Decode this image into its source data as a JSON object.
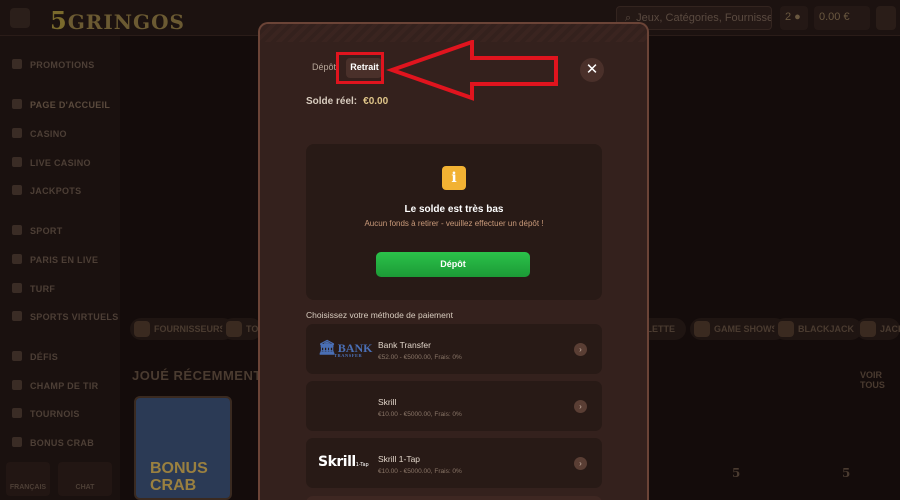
{
  "header": {
    "logo_number": "5",
    "logo_text": "GRINGOS",
    "search_placeholder": "Jeux, Catégories, Fournisseurs",
    "coins": "2",
    "balance": "0.00 €"
  },
  "sidebar": {
    "items": [
      {
        "label": "PROMOTIONS",
        "icon": "gift-icon"
      },
      {
        "label": "PAGE D'ACCUEIL",
        "icon": "home-icon"
      },
      {
        "label": "CASINO",
        "icon": "slot-icon"
      },
      {
        "label": "LIVE CASINO",
        "icon": "live-icon"
      },
      {
        "label": "JACKPOTS",
        "icon": "jackpot-icon"
      },
      {
        "label": "SPORT",
        "icon": "ball-icon"
      },
      {
        "label": "PARIS EN LIVE",
        "icon": "live-bet-icon"
      },
      {
        "label": "TURF",
        "icon": "horse-icon"
      },
      {
        "label": "SPORTS VIRTUELS",
        "icon": "virtual-icon"
      },
      {
        "label": "DÉFIS",
        "icon": "challenge-icon"
      },
      {
        "label": "CHAMP DE TIR",
        "icon": "target-icon"
      },
      {
        "label": "TOURNOIS",
        "icon": "trophy-icon"
      },
      {
        "label": "BONUS CRAB",
        "icon": "crab-icon"
      }
    ],
    "footer": {
      "language": "FRANÇAIS",
      "chat": "CHAT"
    }
  },
  "main": {
    "recent_title": "JOUÉ RÉCEMMENT",
    "see_all": "VOIR TOUS",
    "categories": [
      "FOURNISSEURS",
      "TO",
      "ULETTE",
      "GAME SHOWS",
      "BLACKJACK",
      "JACK"
    ],
    "game_card_title": "BONUS CRAB"
  },
  "modal": {
    "tabs": {
      "depot": "Dépôt",
      "retrait": "Retrait"
    },
    "balance_label": "Solde réel:",
    "balance_value": "€0.00",
    "warning_icon_glyph": "i",
    "low_title": "Le solde est très bas",
    "low_message": "Aucun fonds à retirer - veuillez effectuer un dépôt !",
    "deposit_button": "Dépôt",
    "choose_method": "Choisissez votre méthode de paiement",
    "methods": [
      {
        "name": "Bank Transfer",
        "limits": "€52.00 - €5000.00, Frais: 0%",
        "logo": "BANK",
        "logo_sub": "TRANSFER"
      },
      {
        "name": "Skrill",
        "limits": "€10.00 - €5000.00, Frais: 0%",
        "logo": ""
      },
      {
        "name": "Skrill 1-Tap",
        "limits": "€10.00 - €5000.00, Frais: 0%",
        "logo": "Skrill",
        "logo_sub": "1-Tap"
      }
    ]
  },
  "colors": {
    "accent_green": "#22b042",
    "warning_yellow": "#f2b233",
    "annotation_red": "#e0141e",
    "modal_bg": "#34211d"
  }
}
